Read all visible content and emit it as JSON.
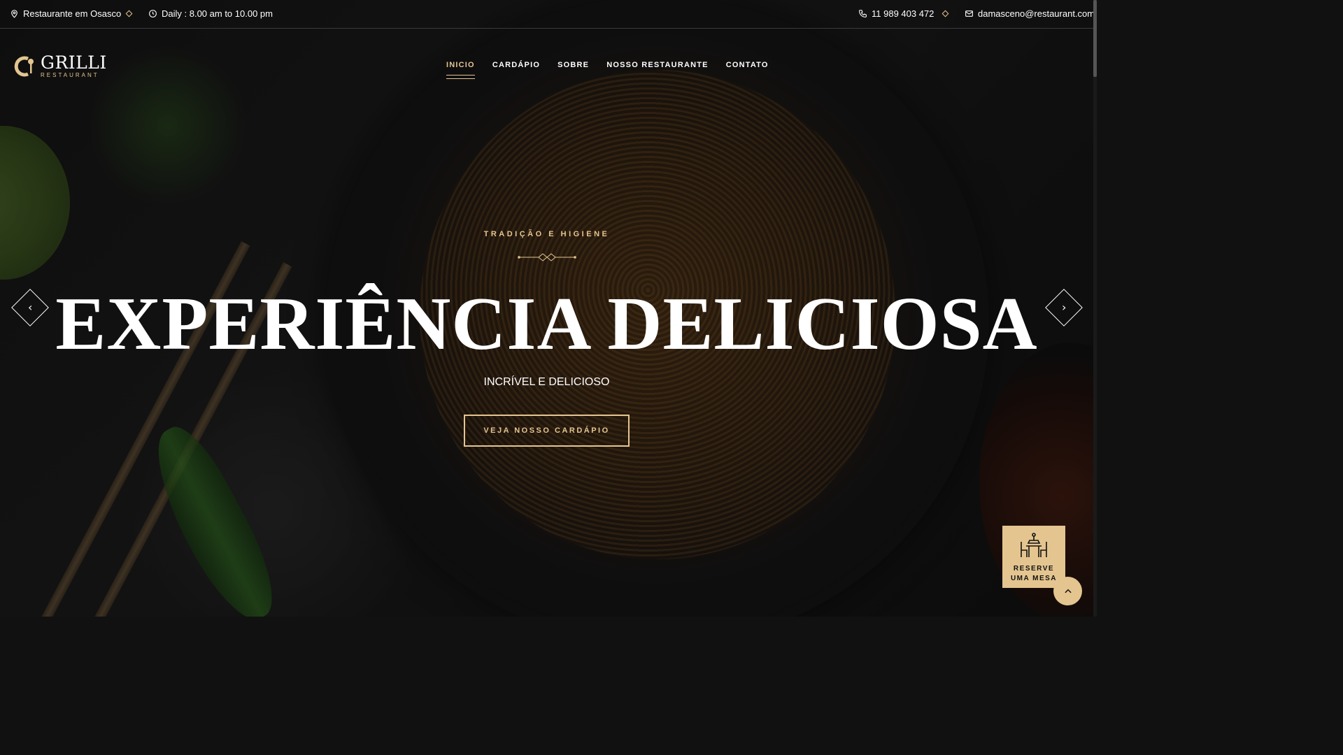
{
  "topbar": {
    "location": "Restaurante em Osasco",
    "hours": "Daily : 8.00 am to 10.00 pm",
    "phone": "11 989 403 472",
    "email": "damasceno@restaurant.com"
  },
  "logo": {
    "name": "GRILLI",
    "sub": "RESTAURANT"
  },
  "nav": {
    "items": [
      {
        "label": "INICIO",
        "active": true
      },
      {
        "label": "CARDÁPIO"
      },
      {
        "label": "SOBRE"
      },
      {
        "label": "NOSSO RESTAURANTE"
      },
      {
        "label": "CONTATO"
      }
    ]
  },
  "hero": {
    "subtitle": "TRADIÇÃO E HIGIENE",
    "headline": "EXPERIÊNCIA DELICIOSA",
    "tagline": "INCRÍVEL E DELICIOSO",
    "cta": "VEJA NOSSO CARDÁPIO",
    "prev_icon": "chevron-left-icon",
    "next_icon": "chevron-right-icon"
  },
  "reserve": {
    "line1": "RESERVE",
    "line2": "UMA MESA",
    "icon": "table-icon"
  },
  "colors": {
    "accent": "#e4c590",
    "text": "#ffffff"
  }
}
